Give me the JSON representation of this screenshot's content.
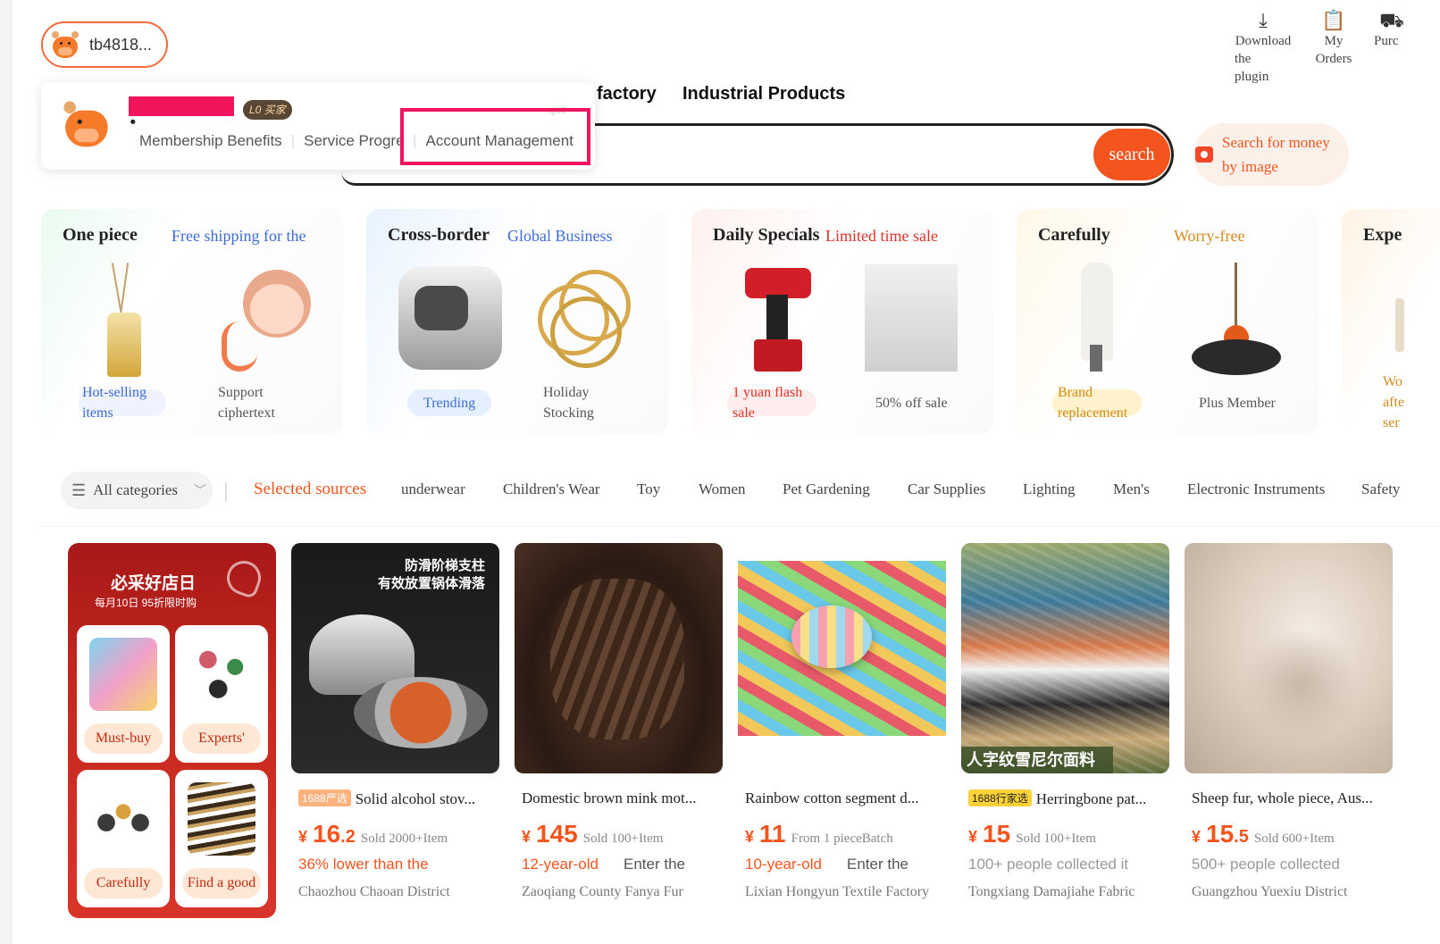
{
  "header": {
    "username": "tb4818...",
    "tools": [
      {
        "icon": "download-icon",
        "label": "Download the plugin",
        "lines": [
          "Download",
          "the",
          "plugin"
        ]
      },
      {
        "icon": "clipboard-icon",
        "label": "My Orders"
      },
      {
        "icon": "cart-icon",
        "label": "Purc"
      }
    ],
    "nav_words": [
      "factory",
      "Industrial Products"
    ]
  },
  "dropdown": {
    "badge": "L0 买家",
    "quit": "quit",
    "links": [
      "Membership Benefits",
      "Service Progress",
      "Account Management"
    ]
  },
  "search": {
    "button_label": "search",
    "image_search_lines": [
      "Search for money",
      "by image"
    ]
  },
  "promos": [
    {
      "title": "One piece",
      "subtitle": "Free shipping for the",
      "items": [
        {
          "label_lines": [
            "Hot-selling",
            "items"
          ]
        },
        {
          "label_lines": [
            "Support",
            "ciphertext"
          ]
        }
      ]
    },
    {
      "title": "Cross-border",
      "subtitle": "Global Business",
      "items": [
        {
          "label_lines": [
            "Trending"
          ]
        },
        {
          "label_lines": [
            "Holiday",
            "Stocking"
          ]
        }
      ]
    },
    {
      "title": "Daily Specials",
      "subtitle": "Limited time sale",
      "items": [
        {
          "label_lines": [
            "1 yuan flash",
            "sale"
          ]
        },
        {
          "label_lines": [
            "50% off sale"
          ]
        }
      ]
    },
    {
      "title": "Carefully",
      "subtitle": "Worry-free",
      "items": [
        {
          "label_lines": [
            "Brand",
            "replacement"
          ]
        },
        {
          "label_lines": [
            "Plus Member"
          ]
        }
      ]
    },
    {
      "title": "Expe",
      "subtitle": "",
      "items": [
        {
          "label_lines": [
            "Wo",
            "afte",
            "ser"
          ]
        }
      ]
    }
  ],
  "categories": {
    "all_label": "All categories",
    "items": [
      "Selected sources",
      "underwear",
      "Children's Wear",
      "Toy",
      "Women",
      "Pet Gardening",
      "Car Supplies",
      "Lighting",
      "Men's",
      "Electronic Instruments",
      "Safety"
    ]
  },
  "feature": {
    "heading": "必采好店日",
    "subheading": "每月10日  95折限时购",
    "tiles": [
      "Must-buy",
      "Experts'",
      "Carefully",
      "Find a good"
    ]
  },
  "products": [
    {
      "tag": "1688严选",
      "title": "Solid alcohol stov...",
      "price_int": "16",
      "price_dec": ".2",
      "sold": "Sold 2000+Item",
      "extra": "36% lower than the",
      "extra2": "",
      "location": "Chaozhou Chaoan District",
      "image_text_lines": [
        "防滑阶梯支柱",
        "有效放置锅体滑落"
      ]
    },
    {
      "tag": "",
      "title": "Domestic brown mink mot...",
      "price_int": "145",
      "price_dec": "",
      "sold": "Sold 100+Item",
      "extra": "12-year-old",
      "extra2": "Enter the",
      "location": "Zaoqiang County Fanya Fur"
    },
    {
      "tag": "",
      "title": "Rainbow cotton segment d...",
      "price_int": "11",
      "price_dec": "",
      "sold": "From 1 pieceBatch",
      "extra": "10-year-old",
      "extra2": "Enter the",
      "location": "Lixian Hongyun Textile Factory"
    },
    {
      "tag": "1688行家选",
      "title": "Herringbone pat...",
      "price_int": "15",
      "price_dec": "",
      "sold": "Sold 100+Item",
      "extra": "100+ people collected it",
      "extra2": "",
      "location": "Tongxiang Damajiahe Fabric",
      "image_text_lines": [
        "人字纹雪尼尔面料"
      ]
    },
    {
      "tag": "",
      "title": "Sheep fur, whole piece, Aus...",
      "price_int": "15",
      "price_dec": ".5",
      "sold": "Sold 600+Item",
      "extra": "500+ people collected",
      "extra2": "",
      "location": "Guangzhou Yuexiu District"
    }
  ],
  "currency": "¥",
  "colors": {
    "accent": "#f4551f",
    "highlight": "#f2155c"
  }
}
